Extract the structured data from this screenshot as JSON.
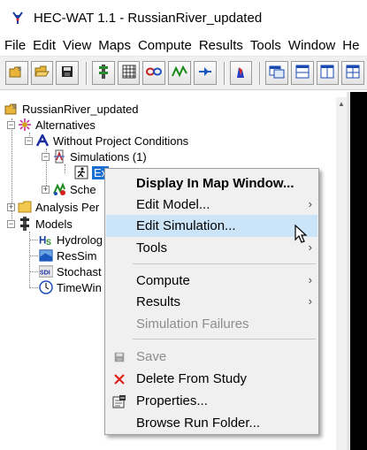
{
  "window": {
    "title": "HEC-WAT 1.1 - RussianRiver_updated",
    "app_icon": "hec-wat-logo-icon"
  },
  "menubar": {
    "items": [
      "File",
      "Edit",
      "View",
      "Maps",
      "Compute",
      "Results",
      "Tools",
      "Window",
      "He"
    ]
  },
  "toolbar": {
    "buttons": [
      "open-study-icon",
      "open-folder-icon",
      "save-icon",
      "model-link-icon",
      "grid-icon",
      "link-icon",
      "wave-icon",
      "pump-icon",
      "chart-icon",
      "window-1-icon",
      "window-2-icon",
      "window-3-icon",
      "window-4-icon"
    ]
  },
  "tree": {
    "root": "RussianRiver_updated",
    "alternatives": "Alternatives",
    "without_project": "Without Project Conditions",
    "simulations": "Simulations (1)",
    "selected_node": "Ex",
    "schedule": "Sche",
    "analysis_periods": "Analysis Per",
    "models": "Models",
    "hydrologic": "Hydrolog",
    "ressim": "ResSim",
    "stochastic": "Stochast",
    "timewindow": "TimeWin"
  },
  "context_menu": {
    "items": [
      {
        "label": "Display In Map Window...",
        "bold": true
      },
      {
        "label": "Edit Model...",
        "submenu": true
      },
      {
        "label": "Edit Simulation...",
        "highlighted": true
      },
      {
        "label": "Tools",
        "submenu": true
      },
      {
        "label": "Compute",
        "submenu": true
      },
      {
        "label": "Results",
        "submenu": true
      },
      {
        "label": "Simulation Failures",
        "disabled": true
      },
      {
        "label": "Save",
        "disabled": true
      },
      {
        "label": "Delete From Study"
      },
      {
        "label": "Properties..."
      },
      {
        "label": "Browse Run Folder..."
      }
    ]
  },
  "colors": {
    "selection": "#1a6fd0",
    "menu_highlight": "#cce4f7",
    "menu_bg": "#f0f0f0"
  }
}
